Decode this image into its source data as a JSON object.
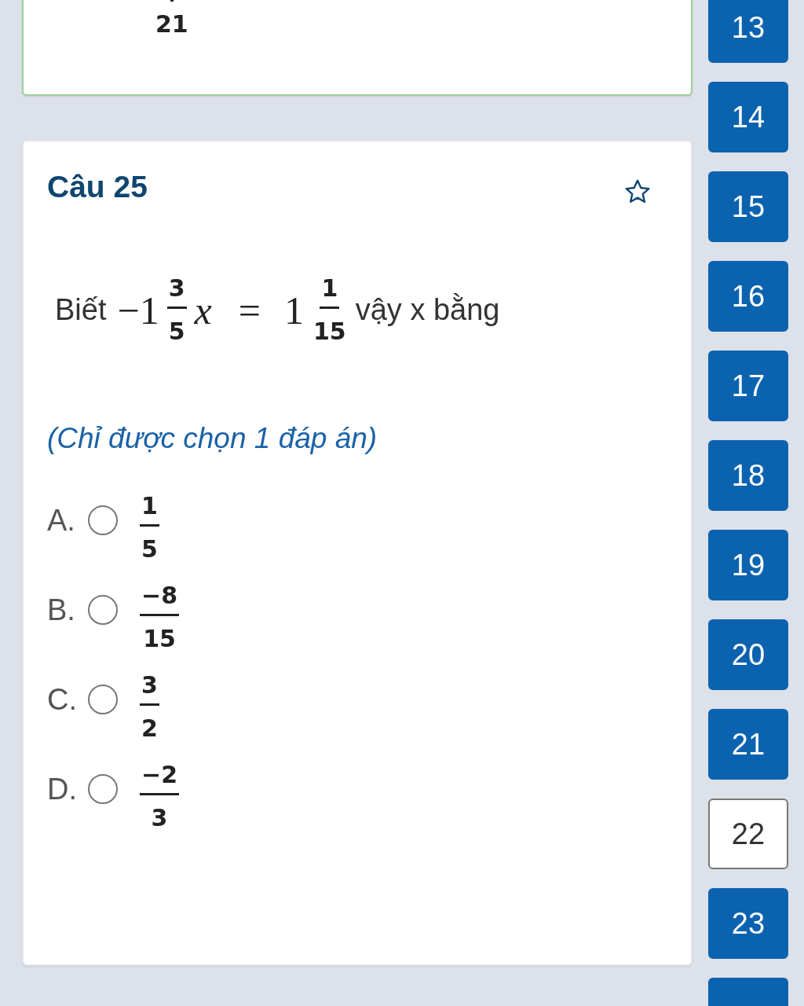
{
  "previous_card": {
    "answered": true,
    "answer_denominator": "21"
  },
  "question": {
    "title": "Câu 25",
    "flagged": false,
    "prefix": "Biết",
    "math": [
      {
        "kind": "text",
        "text": "−1"
      },
      {
        "kind": "fraction",
        "numerator": "3",
        "denominator": "5"
      },
      {
        "kind": "var",
        "text": "x"
      },
      {
        "kind": "op",
        "text": "="
      },
      {
        "kind": "text",
        "text": "1"
      },
      {
        "kind": "fraction",
        "numerator": "1",
        "denominator": "15"
      }
    ],
    "suffix": "vậy x bằng",
    "hint": "(Chỉ được chọn 1 đáp án)",
    "options": [
      {
        "letter": "A.",
        "numerator": "1",
        "denominator": "5",
        "selected": false
      },
      {
        "letter": "B.",
        "numerator": "−8",
        "denominator": "15",
        "selected": false
      },
      {
        "letter": "C.",
        "numerator": "3",
        "denominator": "2",
        "selected": false
      },
      {
        "letter": "D.",
        "numerator": "−2",
        "denominator": "3",
        "selected": false
      }
    ]
  },
  "navigator": [
    {
      "label": "13",
      "answered": true
    },
    {
      "label": "14",
      "answered": true
    },
    {
      "label": "15",
      "answered": true
    },
    {
      "label": "16",
      "answered": true
    },
    {
      "label": "17",
      "answered": true
    },
    {
      "label": "18",
      "answered": true
    },
    {
      "label": "19",
      "answered": true
    },
    {
      "label": "20",
      "answered": true
    },
    {
      "label": "21",
      "answered": true
    },
    {
      "label": "22",
      "answered": false
    },
    {
      "label": "23",
      "answered": true
    },
    {
      "answered": true
    }
  ]
}
